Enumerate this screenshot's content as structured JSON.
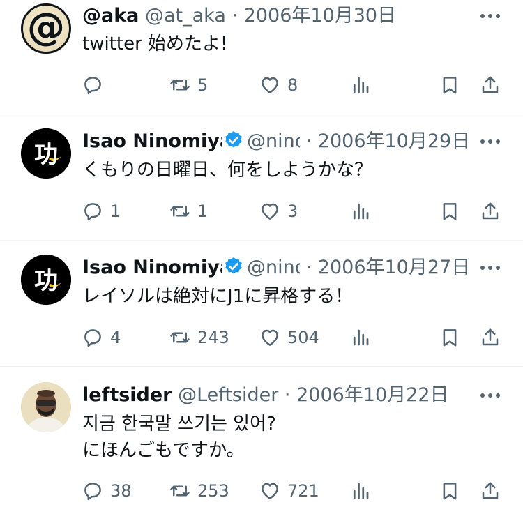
{
  "tweets": [
    {
      "name": "@aka",
      "handle": "@at_aka",
      "separator": "·",
      "date": "2006年10月30日",
      "verified": false,
      "text_lines": [
        "twitter 始めたよ!"
      ],
      "reply_count": "",
      "retweet_count": "5",
      "like_count": "8",
      "avatar_text": "@"
    },
    {
      "name": "Isao Ninomiya",
      "handle": "@nino",
      "separator": "·",
      "date": "2006年10月29日",
      "verified": true,
      "text_lines": [
        "くもりの日曜日、何をしようかな？"
      ],
      "reply_count": "1",
      "retweet_count": "1",
      "like_count": "3",
      "avatar_text": "功"
    },
    {
      "name": "Isao Ninomiya",
      "handle": "@nino",
      "separator": "·",
      "date": "2006年10月27日",
      "verified": true,
      "text_lines": [
        "レイソルは絶対にJ1に昇格する！"
      ],
      "reply_count": "4",
      "retweet_count": "243",
      "like_count": "504",
      "avatar_text": "功"
    },
    {
      "name": "leftsider",
      "handle": "@Leftsider",
      "separator": "·",
      "date": "2006年10月22日",
      "verified": false,
      "text_lines": [
        "지금 한국말 쓰기는 있어?",
        "にほんごもですか。"
      ],
      "reply_count": "38",
      "retweet_count": "253",
      "like_count": "721",
      "avatar_text": ""
    }
  ],
  "colors": {
    "text": "#0f1419",
    "secondary": "#536471",
    "verified": "#1d9bf0",
    "divider": "#eff3f4"
  },
  "icons": {
    "reply": "reply-icon",
    "retweet": "retweet-icon",
    "like": "heart-icon",
    "views": "views-icon",
    "bookmark": "bookmark-icon",
    "share": "share-icon",
    "more": "more-icon",
    "verified": "verified-badge-icon"
  }
}
